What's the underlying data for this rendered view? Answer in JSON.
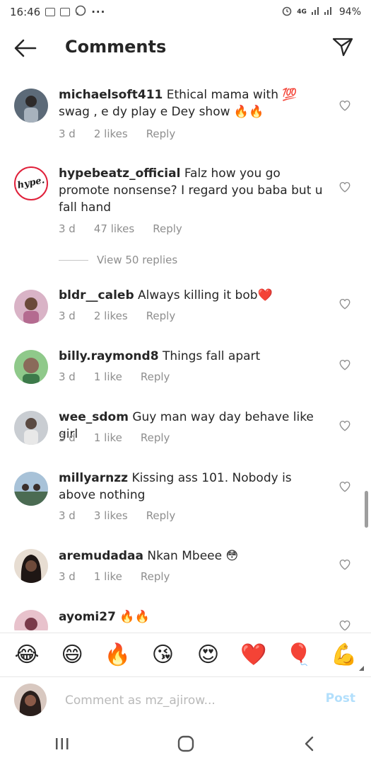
{
  "status_bar": {
    "time": "16:46",
    "more": "···",
    "network": "4G",
    "battery": "94%"
  },
  "header": {
    "title": "Comments"
  },
  "comments": [
    {
      "username": "michaelsoft411",
      "text": "Ethical mama with 💯 swag , e dy play e Dey show 🔥🔥",
      "time": "3 d",
      "likes": "2 likes",
      "reply": "Reply",
      "avatar_color": "#4a5a6a"
    },
    {
      "username": "hypebeatz_official",
      "text": "Falz how you go promote nonsense? I regard you baba but u fall hand",
      "time": "3 d",
      "likes": "47 likes",
      "reply": "Reply",
      "avatar_logo": "hype."
    },
    {
      "username": "bldr__caleb",
      "text": "Always killing it bob❤️",
      "time": "3 d",
      "likes": "2 likes",
      "reply": "Reply",
      "avatar_color": "#c98aa0"
    },
    {
      "username": "billy.raymond8",
      "text": "Things fall apart",
      "time": "3 d",
      "likes": "1 like",
      "reply": "Reply",
      "avatar_color": "#7fb37a"
    },
    {
      "username": "wee_sdom",
      "text": "Guy man way day behave like girl",
      "time": "3 d",
      "likes": "1 like",
      "reply": "Reply",
      "avatar_color": "#8a8f96"
    },
    {
      "username": "millyarnzz",
      "text": "Kissing ass 101. Nobody is above nothing",
      "time": "3 d",
      "likes": "3 likes",
      "reply": "Reply",
      "avatar_color": "#5d7a6b"
    },
    {
      "username": "aremudadaa",
      "text": "Nkan Mbeee 😳",
      "time": "3 d",
      "likes": "1 like",
      "reply": "Reply",
      "avatar_color": "#3a2a25"
    },
    {
      "username": "ayomi27",
      "text": "🔥🔥",
      "avatar_color": "#c46b7b"
    }
  ],
  "view_replies": "View 50 replies",
  "emoji_bar": [
    "😂",
    "😄",
    "🔥",
    "😘",
    "😍",
    "❤️",
    "🎈",
    "💪"
  ],
  "comment_input": {
    "placeholder": "Comment as mz_ajirow...",
    "post_label": "Post"
  },
  "colors": {
    "heart": "#8e8e8e",
    "post_disabled": "#b2dffc",
    "meta": "#8e8e8e"
  }
}
